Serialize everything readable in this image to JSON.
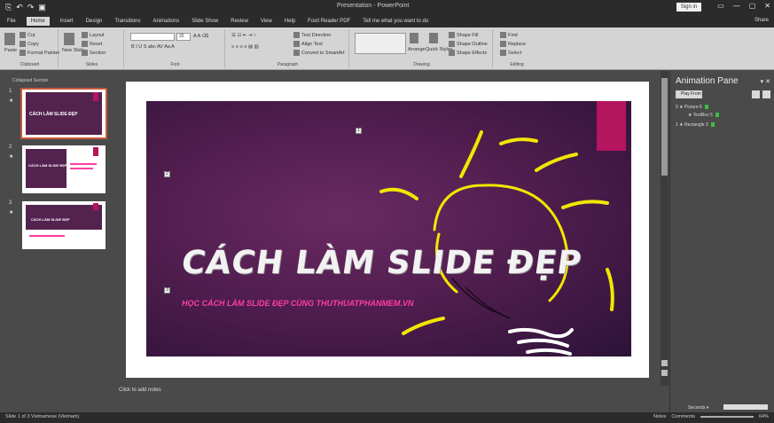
{
  "titlebar": {
    "qa": [
      "⎘",
      "↶",
      "↷",
      "▣"
    ],
    "title": "Presentation - PowerPoint",
    "signin": "Sign in",
    "controls": [
      "▭",
      "—",
      "▢",
      "✕"
    ]
  },
  "tabs": [
    {
      "label": "File",
      "active": false
    },
    {
      "label": "Home",
      "active": true
    },
    {
      "label": "Insert",
      "active": false
    },
    {
      "label": "Design",
      "active": false
    },
    {
      "label": "Transitions",
      "active": false
    },
    {
      "label": "Animations",
      "active": false
    },
    {
      "label": "Slide Show",
      "active": false
    },
    {
      "label": "Review",
      "active": false
    },
    {
      "label": "View",
      "active": false
    },
    {
      "label": "Help",
      "active": false
    },
    {
      "label": "Foxit Reader PDF",
      "active": false
    },
    {
      "label": "Tell me what you want to do",
      "active": false
    }
  ],
  "share": "Share",
  "ribbon": {
    "clipboard": {
      "paste": "Paste",
      "cut": "Cut",
      "copy": "Copy",
      "format_painter": "Format Painter",
      "label": "Clipboard"
    },
    "slides": {
      "new_slide": "New Slide",
      "layout": "Layout",
      "reset": "Reset",
      "section": "Section",
      "label": "Slides"
    },
    "font": {
      "label": "Font",
      "size": "32"
    },
    "paragraph": {
      "text_direction": "Text Direction",
      "align_text": "Align Text",
      "smartart": "Convert to SmartArt",
      "label": "Paragraph"
    },
    "drawing": {
      "arrange": "Arrange",
      "quick_styles": "Quick Styles",
      "shape_fill": "Shape Fill",
      "shape_outline": "Shape Outline",
      "shape_effects": "Shape Effects",
      "label": "Drawing"
    },
    "editing": {
      "find": "Find",
      "replace": "Replace",
      "select": "Select",
      "label": "Editing"
    }
  },
  "thumbs": {
    "title": "Collapsed Section",
    "slides": [
      {
        "num": "1",
        "title": "CÁCH LÀM SLIDE ĐẸP",
        "selected": true
      },
      {
        "num": "2",
        "title": "CÁCH LÀM SLIDE ĐẸP",
        "selected": false
      },
      {
        "num": "3",
        "title": "CÁCH LÀM SLIDE ĐẸP",
        "selected": false
      }
    ]
  },
  "slide": {
    "title": "CÁCH LÀM SLIDE ĐẸP",
    "subtitle": "HỌC CÁCH LÀM SLIDE ĐẸP CÙNG THUTHUATPHANMEM.VN",
    "markers": [
      "1",
      "2",
      "3"
    ]
  },
  "notes": "Click to add notes",
  "animation_pane": {
    "title": "Animation Pane",
    "play_from": "Play From",
    "items": [
      {
        "num": "0",
        "label": "Picture 6"
      },
      {
        "num": "",
        "label": "TextBox 5"
      },
      {
        "num": "1",
        "label": "Rectangle 3"
      }
    ],
    "seconds": "Seconds ▾"
  },
  "status": {
    "left": "Slide 1 of 3   Vietnamese (Vietnam)",
    "right": [
      "Notes",
      "Comments",
      "64%"
    ]
  },
  "colors": {
    "accent": "#b5145e",
    "slide_bg": "#4e1d4d",
    "subtitle": "#ff3ea5",
    "bulb": "#f2e600"
  }
}
